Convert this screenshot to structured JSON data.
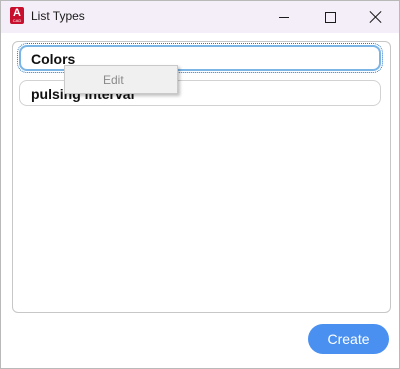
{
  "window": {
    "title": "List Types",
    "icon": "autocad-app-icon",
    "app_icon_letter": "A",
    "app_icon_sub": "CAD",
    "accent_color": "#4a90f0",
    "titlebar_color": "#f4eef8"
  },
  "list": {
    "items": [
      {
        "label": "Colors",
        "selected": true
      },
      {
        "label": "pulsing interval",
        "selected": false
      }
    ]
  },
  "context_menu": {
    "items": [
      {
        "label": "Edit",
        "enabled": false
      }
    ]
  },
  "footer": {
    "create_label": "Create"
  }
}
